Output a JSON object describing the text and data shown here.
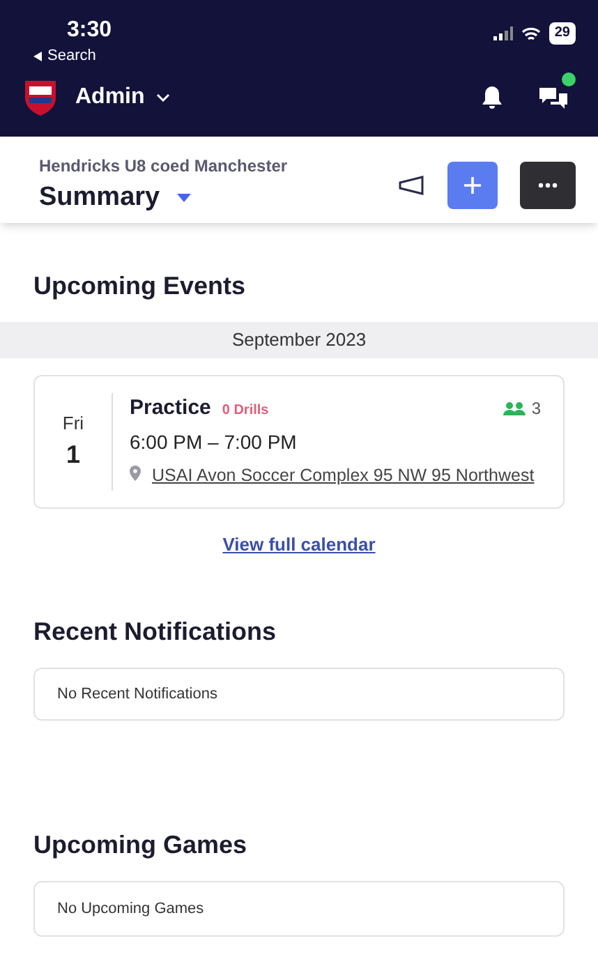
{
  "status_bar": {
    "time": "3:30",
    "back_label": "Search",
    "battery": "29"
  },
  "header": {
    "title": "Admin",
    "has_chat_notification": true
  },
  "subheader": {
    "team": "Hendricks U8 coed Manchester",
    "view": "Summary"
  },
  "upcoming_events": {
    "title": "Upcoming Events",
    "month": "September 2023",
    "events": [
      {
        "weekday": "Fri",
        "day": "1",
        "name": "Practice",
        "drills": "0 Drills",
        "attendees": "3",
        "time": "6:00 PM – 7:00 PM",
        "location": "USAI Avon Soccer Complex 95 NW 95 Northwest"
      }
    ],
    "link": "View full calendar"
  },
  "recent_notifications": {
    "title": "Recent Notifications",
    "empty_text": "No Recent Notifications"
  },
  "upcoming_games": {
    "title": "Upcoming Games",
    "empty_text": "No Upcoming Games"
  }
}
